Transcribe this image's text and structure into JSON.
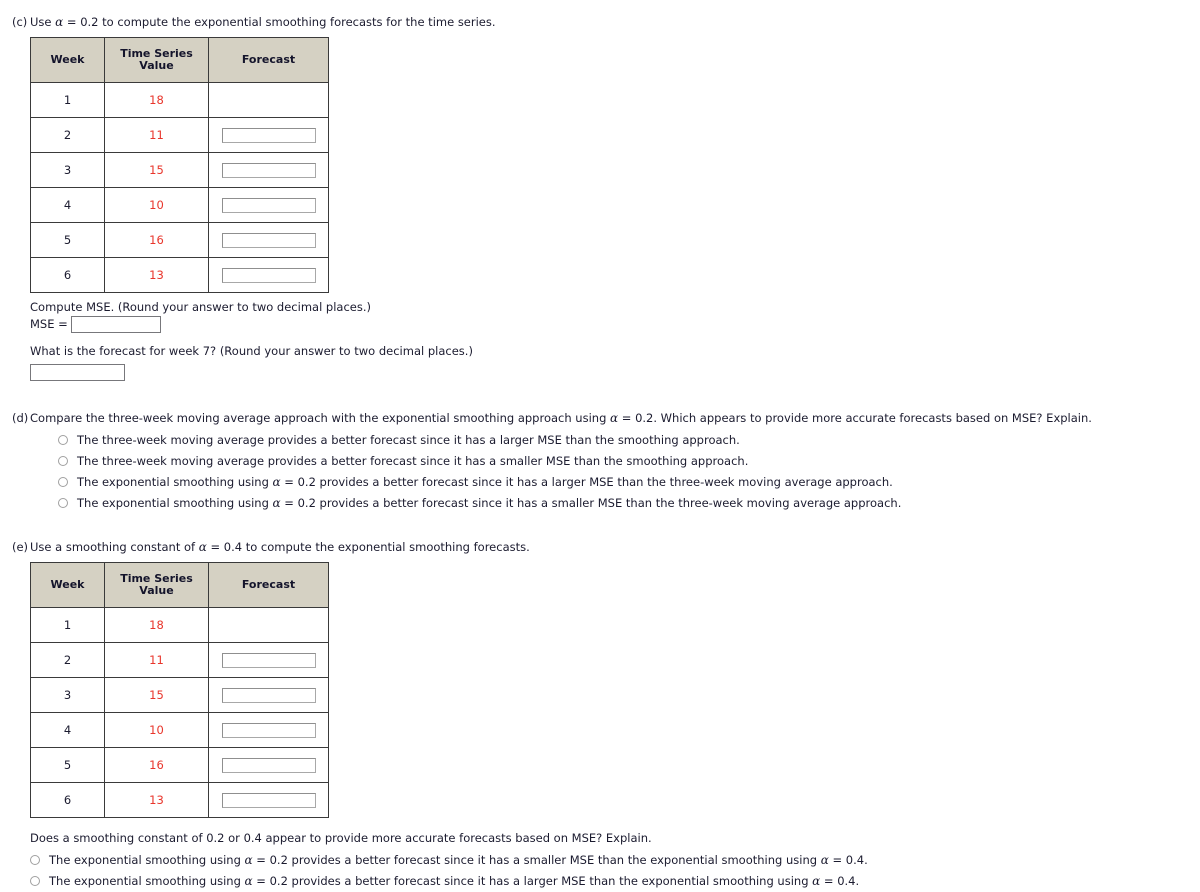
{
  "table_headers": [
    "Week",
    "Time Series Value",
    "Forecast"
  ],
  "parts": {
    "c": {
      "label": "(c)",
      "prompt_pre": "Use ",
      "prompt_alpha": "α",
      "prompt_post": " = 0.2 to compute the exponential smoothing forecasts for the time series.",
      "rows": [
        {
          "week": "1",
          "value": "18",
          "has_input": false,
          "input_value": ""
        },
        {
          "week": "2",
          "value": "11",
          "has_input": true,
          "input_value": ""
        },
        {
          "week": "3",
          "value": "15",
          "has_input": true,
          "input_value": ""
        },
        {
          "week": "4",
          "value": "10",
          "has_input": true,
          "input_value": ""
        },
        {
          "week": "5",
          "value": "16",
          "has_input": true,
          "input_value": ""
        },
        {
          "week": "6",
          "value": "13",
          "has_input": true,
          "input_value": ""
        }
      ],
      "mse_prompt": "Compute MSE. (Round your answer to two decimal places.)",
      "mse_equals_label": "MSE =",
      "mse_input_value": "",
      "week7_prompt": "What is the forecast for week 7? (Round your answer to two decimal places.)",
      "week7_input_value": ""
    },
    "d": {
      "label": "(d)",
      "prompt_pre": "Compare the three-week moving average approach with the exponential smoothing approach using ",
      "prompt_alpha": "α",
      "prompt_post": " = 0.2. Which appears to provide more accurate forecasts based on MSE? Explain.",
      "options": [
        {
          "pre": "The three-week moving average provides a better forecast since it has a larger MSE than the smoothing approach.",
          "alpha": "",
          "post": "",
          "selected": false
        },
        {
          "pre": "The three-week moving average provides a better forecast since it has a smaller MSE than the smoothing approach.",
          "alpha": "",
          "post": "",
          "selected": false
        },
        {
          "pre": "The exponential smoothing using ",
          "alpha": "α",
          "post": " = 0.2 provides a better forecast since it has a larger MSE than the three-week moving average approach.",
          "selected": false
        },
        {
          "pre": "The exponential smoothing using ",
          "alpha": "α",
          "post": " = 0.2 provides a better forecast since it has a smaller MSE than the three-week moving average approach.",
          "selected": false
        }
      ]
    },
    "e": {
      "label": "(e)",
      "prompt_pre": "Use a smoothing constant of ",
      "prompt_alpha": "α",
      "prompt_post": " = 0.4 to compute the exponential smoothing forecasts.",
      "rows": [
        {
          "week": "1",
          "value": "18",
          "has_input": false,
          "input_value": ""
        },
        {
          "week": "2",
          "value": "11",
          "has_input": true,
          "input_value": ""
        },
        {
          "week": "3",
          "value": "15",
          "has_input": true,
          "input_value": ""
        },
        {
          "week": "4",
          "value": "10",
          "has_input": true,
          "input_value": ""
        },
        {
          "week": "5",
          "value": "16",
          "has_input": true,
          "input_value": ""
        },
        {
          "week": "6",
          "value": "13",
          "has_input": true,
          "input_value": ""
        }
      ],
      "question": "Does a smoothing constant of 0.2 or 0.4 appear to provide more accurate forecasts based on MSE? Explain.",
      "options": [
        {
          "pre": "The exponential smoothing using ",
          "alpha": "α",
          "mid": " = 0.2 provides a better forecast since it has a smaller MSE than the exponential smoothing using ",
          "alpha2": "α",
          "post": " = 0.4.",
          "selected": false
        },
        {
          "pre": "The exponential smoothing using ",
          "alpha": "α",
          "mid": " = 0.2 provides a better forecast since it has a larger MSE than the exponential smoothing using ",
          "alpha2": "α",
          "post": " = 0.4.",
          "selected": false
        }
      ]
    }
  },
  "colors": {
    "header_bg": "#d5d1c3",
    "value_red": "#e8352b",
    "text": "#1b1b2f",
    "border": "#3a3a3a"
  }
}
